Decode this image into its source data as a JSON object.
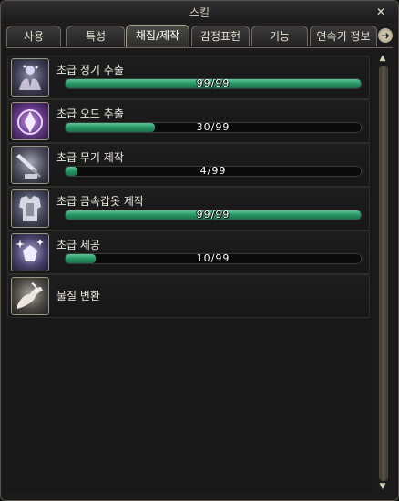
{
  "window": {
    "title": "스킬",
    "close_glyph": "✕"
  },
  "tabs": [
    {
      "label": "사용",
      "active": false
    },
    {
      "label": "특성",
      "active": false
    },
    {
      "label": "채집/제작",
      "active": true
    },
    {
      "label": "감정표현",
      "active": false
    },
    {
      "label": "기능",
      "active": false
    },
    {
      "label": "연속기 정보",
      "active": false
    }
  ],
  "tab_next_glyph": "➜",
  "skills": [
    {
      "name": "초급 정기 추출",
      "current": 99,
      "max": 99,
      "progress_text": "99/99",
      "icon": "essence-extraction-icon"
    },
    {
      "name": "초급 오드 추출",
      "current": 30,
      "max": 99,
      "progress_text": "30/99",
      "icon": "aether-extraction-icon"
    },
    {
      "name": "초급 무기 제작",
      "current": 4,
      "max": 99,
      "progress_text": "4/99",
      "icon": "weaponsmithing-icon"
    },
    {
      "name": "초급 금속갑옷 제작",
      "current": 99,
      "max": 99,
      "progress_text": "99/99",
      "icon": "armorsmithing-icon"
    },
    {
      "name": "초급 세공",
      "current": 10,
      "max": 99,
      "progress_text": "10/99",
      "icon": "handicrafting-icon"
    },
    {
      "name": "물질 변환",
      "icon": "morph-substance-icon"
    }
  ],
  "scrollbar": {
    "up_glyph": "▲",
    "down_glyph": "▼"
  },
  "colors": {
    "bar_fill": "#239062",
    "accent_border": "#a8a290"
  }
}
